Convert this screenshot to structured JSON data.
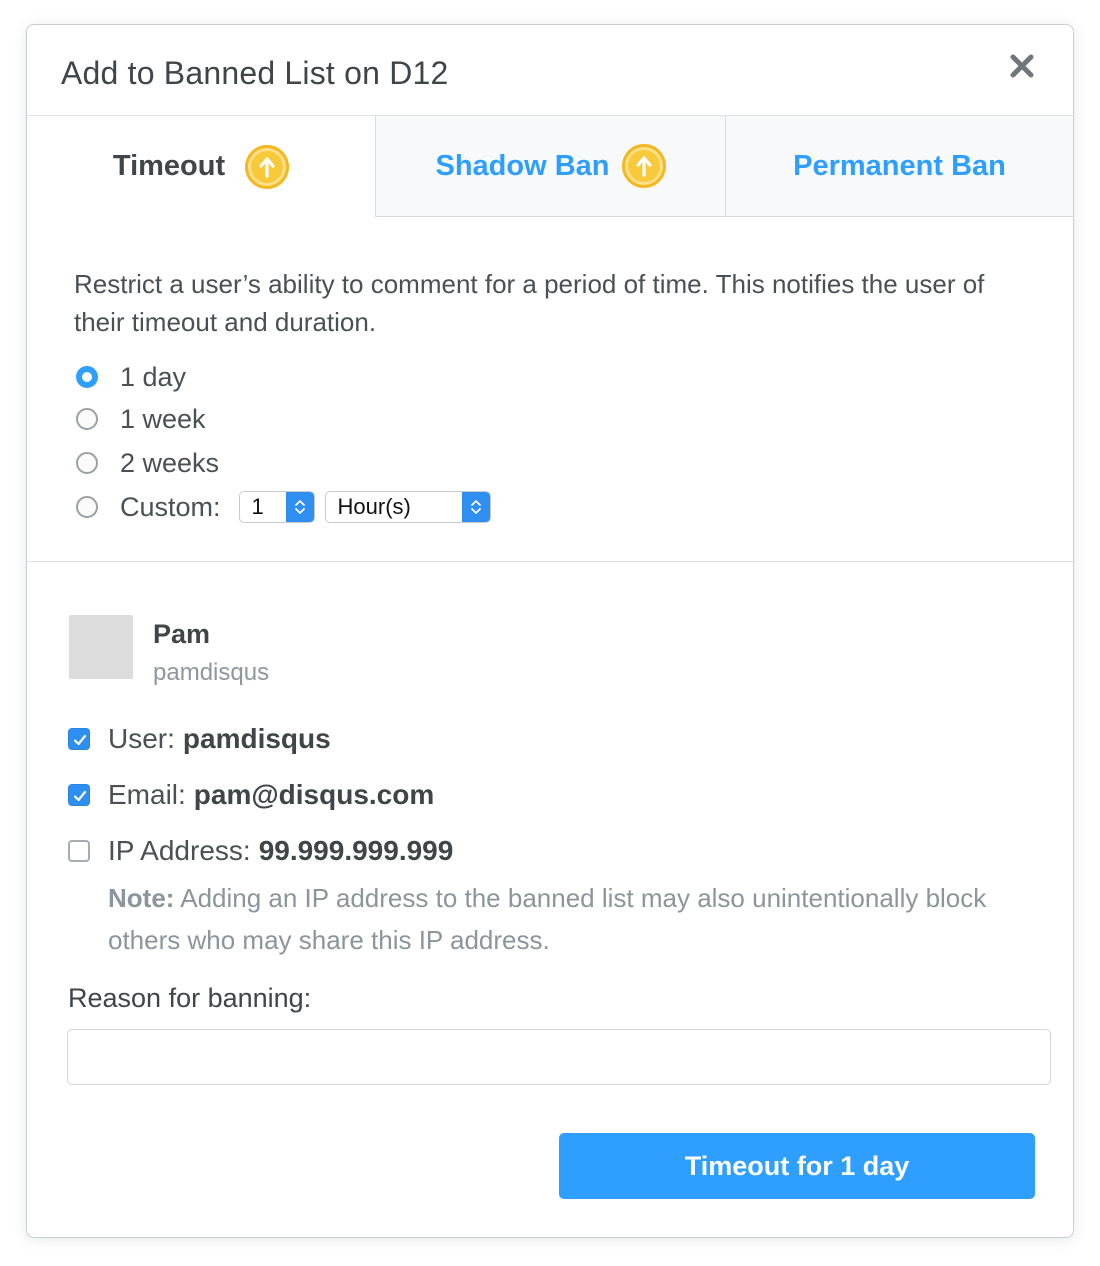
{
  "dialog": {
    "title": "Add to Banned List on D12"
  },
  "tabs": [
    {
      "label": "Timeout",
      "active": true,
      "badge": "upgrade-arrow-icon"
    },
    {
      "label": "Shadow Ban",
      "active": false,
      "badge": "upgrade-arrow-icon"
    },
    {
      "label": "Permanent Ban",
      "active": false
    }
  ],
  "timeout": {
    "description": "Restrict a user’s ability to comment for a period of time. This notifies the user of their timeout and duration.",
    "options": [
      {
        "label": "1 day",
        "selected": true
      },
      {
        "label": "1 week",
        "selected": false
      },
      {
        "label": "2 weeks",
        "selected": false
      },
      {
        "label": "Custom:",
        "selected": false
      }
    ],
    "custom_amount": "1",
    "custom_unit": "Hour(s)"
  },
  "user": {
    "name": "Pam",
    "handle": "pamdisqus"
  },
  "ban_targets": [
    {
      "label": "User:",
      "value": "pamdisqus",
      "checked": true
    },
    {
      "label": "Email:",
      "value": "pam@disqus.com",
      "checked": true
    },
    {
      "label": "IP Address:",
      "value": "99.999.999.999",
      "checked": false
    }
  ],
  "note": {
    "prefix": "Note:",
    "text": " Adding an IP address to the banned list may also unintentionally block others who may share this IP address."
  },
  "reason": {
    "label": "Reason for banning:",
    "value": ""
  },
  "submit_label": "Timeout for 1 day",
  "colors": {
    "accent": "#2e9fff",
    "badge": "#f8c93b",
    "text": "#3f4549"
  }
}
